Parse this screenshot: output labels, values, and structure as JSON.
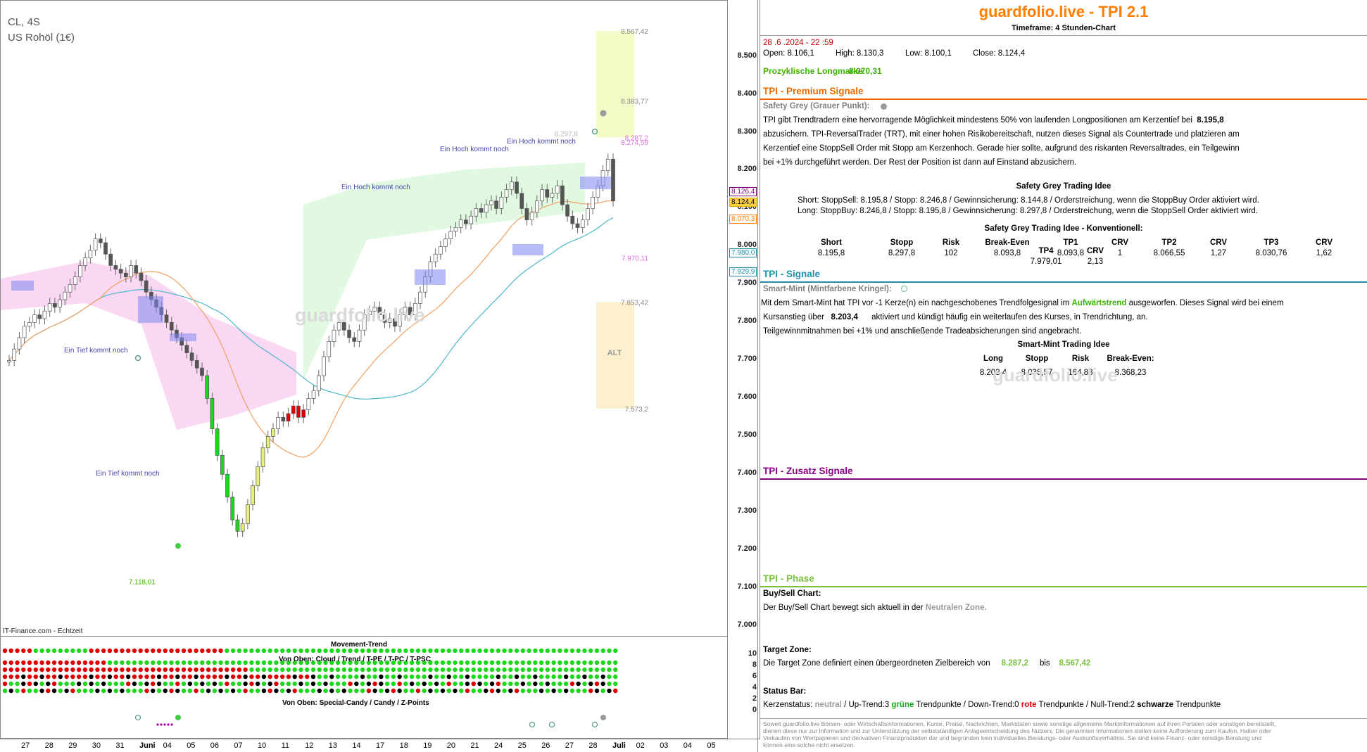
{
  "chart_header": {
    "symbol": "CL, 4S",
    "name": "US Rohöl (1€)",
    "source": "IT-Finance.com - Echtzeit",
    "watermark": "guardfolio.live",
    "watermark2": "guardfolio.live"
  },
  "colors": {
    "orange": "#ff7f00",
    "premium": "#e86a00",
    "teal": "#1f8fa8",
    "purple": "#800080",
    "green": "#7ac143",
    "grey_dot": "#9a9a9a",
    "mint": "#5fbf9f",
    "up": "#1ed61e",
    "down": "#e00000",
    "neutral": "#000000"
  },
  "chart_data": {
    "type": "candlestick",
    "title": "CL, 4S",
    "subtitle": "US Rohöl (1€)",
    "ylim": [
      6.98,
      8.64
    ],
    "y_ticks": [
      "8.500",
      "8.400",
      "8.300",
      "8.200",
      "8.100",
      "8.000",
      "7.900",
      "7.800",
      "7.700",
      "7.600",
      "7.500",
      "7.400",
      "7.300",
      "7.200",
      "7.100",
      "7.000"
    ],
    "x_ticks": [
      "27",
      "28",
      "29",
      "30",
      "31",
      "Juni",
      "04",
      "05",
      "06",
      "07",
      "10",
      "11",
      "12",
      "13",
      "14",
      "17",
      "18",
      "19",
      "20",
      "21",
      "24",
      "25",
      "26",
      "27",
      "28",
      "Juli",
      "02",
      "03",
      "04",
      "05"
    ],
    "close_series": [
      7.7,
      7.73,
      7.76,
      7.79,
      7.8,
      7.82,
      7.81,
      7.83,
      7.85,
      7.84,
      7.86,
      7.88,
      7.9,
      7.92,
      7.95,
      7.97,
      7.99,
      8.02,
      8.01,
      7.98,
      7.95,
      7.94,
      7.93,
      7.92,
      7.95,
      7.93,
      7.91,
      7.88,
      7.86,
      7.84,
      7.82,
      7.8,
      7.78,
      7.76,
      7.74,
      7.72,
      7.7,
      7.68,
      7.66,
      7.6,
      7.52,
      7.45,
      7.4,
      7.34,
      7.28,
      7.25,
      7.27,
      7.32,
      7.37,
      7.42,
      7.47,
      7.5,
      7.52,
      7.55,
      7.54,
      7.56,
      7.58,
      7.55,
      7.57,
      7.6,
      7.62,
      7.66,
      7.71,
      7.75,
      7.78,
      7.8,
      7.78,
      7.76,
      7.75,
      7.78,
      7.82,
      7.83,
      7.84,
      7.82,
      7.8,
      7.81,
      7.79,
      7.82,
      7.84,
      7.82,
      7.85,
      7.88,
      7.92,
      7.96,
      7.98,
      8.0,
      8.02,
      8.04,
      8.05,
      8.07,
      8.06,
      8.08,
      8.1,
      8.09,
      8.11,
      8.12,
      8.1,
      8.13,
      8.15,
      8.17,
      8.14,
      8.1,
      8.07,
      8.09,
      8.12,
      8.15,
      8.13,
      8.14,
      8.16,
      8.11,
      8.08,
      8.06,
      8.05,
      8.07,
      8.1,
      8.13,
      8.16,
      8.2,
      8.23,
      8.12
    ],
    "last_close": "8.124,4",
    "labels": [
      {
        "text": "Ein Tief kommt noch",
        "x": "31",
        "y": 7.7
      },
      {
        "text": "Ein Tief kommt noch",
        "x": "04",
        "y": 7.28
      },
      {
        "text": "Ein Hoch kommt noch",
        "x": "18",
        "y": 8.06
      },
      {
        "text": "Ein Hoch kommt noch",
        "x": "24",
        "y": 8.16
      },
      {
        "text": "Ein Hoch kommt noch",
        "x": "27",
        "y": 8.18
      }
    ],
    "levels": [
      {
        "value": 8.56742,
        "label": "8.567,42"
      },
      {
        "value": 8.38377,
        "label": "8.383,77"
      },
      {
        "value": 8.2978,
        "label": "8.297,8"
      },
      {
        "value": 8.2872,
        "label": "8.287,2"
      },
      {
        "value": 8.27459,
        "label": "8.274,59"
      },
      {
        "value": 7.97011,
        "label": "7.970,11"
      },
      {
        "value": 7.85342,
        "label": "7.853,42"
      },
      {
        "value": 7.5732,
        "label": "7.573,2"
      },
      {
        "value": 7.11801,
        "label": "7.118,01"
      }
    ],
    "target_zone": {
      "from": 8.2872,
      "to": 8.56742
    },
    "alt_zone": {
      "from": 7.5732,
      "to": 7.85342,
      "label": "ALT"
    },
    "axis_tags": [
      {
        "value": 8.1264,
        "label": "8.126,4",
        "color": "#800080"
      },
      {
        "value": 8.1244,
        "label": "8.124,4",
        "color": "#e8b000"
      },
      {
        "value": 8.0703,
        "label": "8.070,3",
        "color": "#ff7f00"
      },
      {
        "value": 7.98,
        "label": "7.980,0",
        "color": "#1f8fa8"
      },
      {
        "value": 7.9299,
        "label": "7.929,9",
        "color": "#1f8fa8"
      }
    ]
  },
  "indicator": {
    "movement_trend_label": "Movement-Trend",
    "cloud_label": "Von Oben: Cloud / Trend / T-PE / T-PC / T-PSC",
    "special_label": "Von Oben: Special-Candy / Candy / Z-Points",
    "axis_ticks": [
      "10",
      "8",
      "6",
      "4",
      "2",
      "0"
    ]
  },
  "panel": {
    "title": "guardfolio.live - TPI 2.1",
    "timeframe": "Timeframe: 4 Stunden-Chart",
    "datetime": "28 .6 .2024 - 22 :59",
    "ohlc": {
      "open": "Open:  8.106,1",
      "high": "High:  8.130,3",
      "low": "Low:  8.100,1",
      "close": "Close:  8.124,4"
    },
    "longmarke_label": "Prozyklische Longmarke:",
    "longmarke_value": "8.070,31",
    "premium_header": "TPI - Premium Signale",
    "safety_grey_title": "Safety Grey (Grauer Punkt):",
    "sg_l1a": "TPI gibt Trendtradern eine hervorragende Möglichkeit mindestens 50% von laufenden Longpositionen am Kerzentief bei",
    "sg_l1b": "8.195,8",
    "sg_l2": "abzusichern. TPI-ReversalTrader (TRT), mit einer hohen Risikobereitschaft, nutzen dieses Signal als Countertrade und platzieren am",
    "sg_l3": "Kerzentief eine StoppSell Order mit Stopp am Kerzenhoch. Gerade hier sollte, aufgrund des riskanten Reversaltrades, ein Teilgewinn",
    "sg_l4": "bei +1% durchgeführt werden. Der Rest der Position ist dann auf Einstand abzusichern.",
    "sg_idea_title": "Safety Grey Trading Idee",
    "sg_short": "Short: StoppSell:  8.195,8  / Stopp:  8.246,8  / Gewinnsicherung: 8.144,8   / Orderstreichung, wenn die StoppBuy Order aktiviert wird.",
    "sg_long": "Long: StoppBuy:  8.246,8  / Stopp:  8.195,8  / Gewinnsicherung: 8.297,8   / Orderstreichung, wenn die StoppSell Order aktiviert wird.",
    "sg_konv_title": "Safety Grey Trading Idee - Konventionell:",
    "konv_headers": [
      "Short",
      "Stopp",
      "Risk",
      "Break-Even",
      "TP1",
      "CRV",
      "TP2",
      "CRV",
      "TP3",
      "CRV",
      "TP4",
      "CRV"
    ],
    "konv_values": [
      "8.195,8",
      "8.297,8",
      "102",
      "8.093,8",
      "8.093,8",
      "1",
      "8.066,55",
      "1,27",
      "8.030,76",
      "1,62",
      "7.979,01",
      "2,13"
    ],
    "signale_header": "TPI - Signale",
    "mint_title": "Smart-Mint (Mintfarbene Kringel):",
    "mint_l1a": "Mit dem Smart-Mint hat TPI vor -1  Kerze(n) ein nachgeschobenes Trendfolgesignal im",
    "mint_l1b": "Aufwärtstrend",
    "mint_l1c": "ausgeworfen. Dieses Signal wird bei einem",
    "mint_l2a": "Kursanstieg über",
    "mint_l2b": "8.203,4",
    "mint_l2c": "aktiviert und kündigt häufig ein weiterlaufen des Kurses, in Trendrichtung, an.",
    "mint_l3": "Teilgewinnmitnahmen bei +1% und anschließende Tradeabsicherungen sind angebracht.",
    "mint_idea_title": "Smart-Mint Trading Idee",
    "mint_headers": [
      "Long",
      "Stopp",
      "Risk",
      "Break-Even:"
    ],
    "mint_values": [
      "8.203,4",
      "8.038,57",
      "164,83",
      "8.368,23"
    ],
    "zusatz_header": "TPI - Zusatz Signale",
    "phase_header": "TPI - Phase",
    "bs_title": "Buy/Sell Chart:",
    "bs_text": "Der Buy/Sell Chart bewegt sich aktuell in der",
    "bs_zone": "Neutralen Zone.",
    "tz_title": "Target Zone:",
    "tz_text": "Die Target Zone definiert einen übergeordneten Zielbereich von",
    "tz_from": "8.287,2",
    "tz_bis": "bis",
    "tz_to": "8.567,42",
    "sb_title": "Status Bar:",
    "sb_a": "Kerzenstatus:",
    "sb_neutral": "neutral",
    "sb_b": "/ Up-Trend:3",
    "sb_gruene": "grüne",
    "sb_c": "Trendpunkte  / Down-Trend:0",
    "sb_rote": "rote",
    "sb_d": "Trendpunkte  / Null-Trend:2",
    "sb_schwarze": "schwarze",
    "sb_e": "Trendpunkte",
    "disclaimer": "Soweit guardfolio.live Börsen- oder Wirtschaftsinformationen, Kurse, Preise, Nachrichten, Marktdaten sowie sonstige allgemeine Marktinformationen auf ihren Portalen oder sonstigen bereitstellt, dienen diese nur zur Information und zur Unterstützung der selbstständigen Anlageentscheidung des Nutzers. Die genannten Informationen stellen keine Aufforderung zum Kaufen, Halten oder Verkaufen von Wertpapieren und derivativen Finanzprodukten dar und begründen kein individuelles Beratungs- oder Auskunftsverhältnis. Sie sind keine Finanz- oder sonstige Beratung und können eine solche nicht ersetzen."
  }
}
